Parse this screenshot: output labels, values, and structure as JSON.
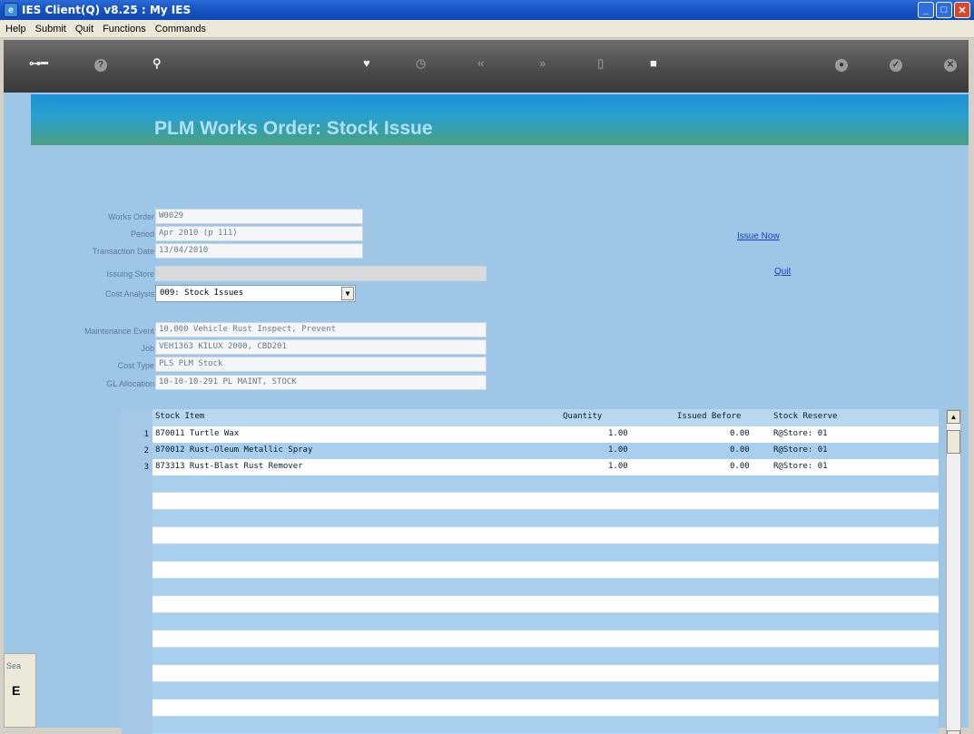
{
  "window": {
    "title": "IES Client(Q) v8.25 : My IES",
    "icon": "ies-app-icon"
  },
  "menu": [
    "Help",
    "Submit",
    "Quit",
    "Functions",
    "Commands"
  ],
  "toolbar": {
    "icons": [
      "key-icon",
      "help-icon",
      "search-icon",
      "heart-icon",
      "clock-icon",
      "rewind-icon",
      "forward-icon",
      "stop-icon",
      "square-icon",
      "record-icon",
      "check-icon",
      "close-icon"
    ]
  },
  "banner": {
    "title": "PLM Works Order: Stock Issue"
  },
  "form": {
    "works_order": {
      "label": "Works Order",
      "value": "W0029"
    },
    "period": {
      "label": "Period",
      "value": "Apr 2010 (p 111)"
    },
    "transaction_date": {
      "label": "Transaction Date",
      "value": "13/04/2010"
    },
    "issuing_store": {
      "label": "Issuing Store",
      "value": ""
    },
    "cost_analysis": {
      "label": "Cost Analysis",
      "value": "009: Stock Issues"
    },
    "maintenance_event": {
      "label": "Maintenance Event",
      "value": "10,000 Vehicle Rust Inspect, Prevent"
    },
    "job": {
      "label": "Job",
      "value": "VEH1363 KILUX 2000, CBD201"
    },
    "cost_type": {
      "label": "Cost Type",
      "value": "PLS PLM Stock"
    },
    "gl_allocation": {
      "label": "GL Allocation",
      "value": "10-10-10-291 PL MAINT, STOCK"
    }
  },
  "actions": {
    "issue_now": "Issue Now",
    "quit": "Quit"
  },
  "grid": {
    "columns": {
      "item": "Stock Item",
      "qty": "Quantity",
      "before": "Issued Before",
      "reserve": "Stock Reserve"
    },
    "rows": [
      {
        "num": "1",
        "item": "870011 Turtle Wax",
        "qty": "1.00",
        "before": "0.00",
        "reserve": "R@Store: 01"
      },
      {
        "num": "2",
        "item": "870012 Rust-Oleum Metallic Spray",
        "qty": "1.00",
        "before": "0.00",
        "reserve": "R@Store: 01"
      },
      {
        "num": "3",
        "item": "873313 Rust-Blast Rust Remover",
        "qty": "1.00",
        "before": "0.00",
        "reserve": "R@Store: 01"
      }
    ]
  },
  "dock": {
    "label": "Sea",
    "char": "E"
  }
}
